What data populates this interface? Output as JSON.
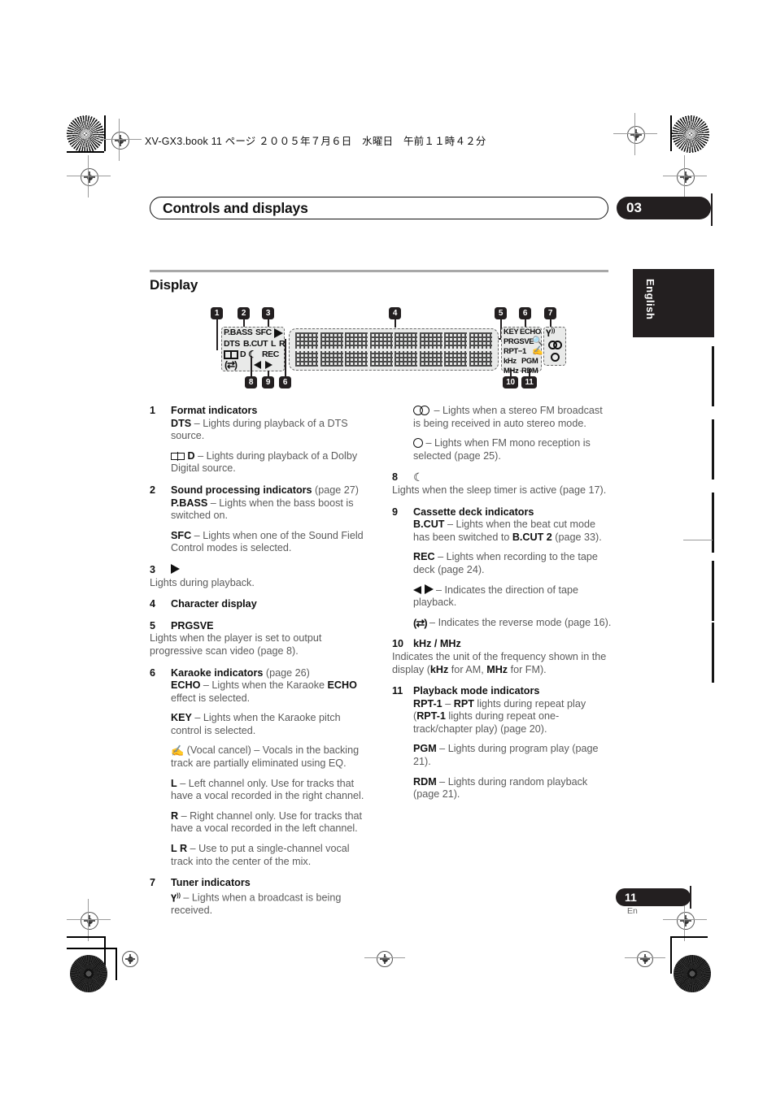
{
  "print_marks": {
    "file_stamp": "XV-GX3.book  11 ページ  ２００５年７月６日　水曜日　午前１１時４２分"
  },
  "header": {
    "chapter_title": "Controls and displays",
    "chapter_number": "03"
  },
  "section": {
    "title": "Display"
  },
  "language_tab": {
    "label": "English"
  },
  "figure": {
    "callouts": [
      "1",
      "2",
      "3",
      "4",
      "5",
      "6",
      "7",
      "8",
      "9",
      "10",
      "11"
    ],
    "lcd_labels": {
      "p_bass": "P.BASS",
      "sfc": "SFC",
      "dts": "DTS",
      "b_cut": "B.CUT",
      "left": "L",
      "right": "R",
      "dolby_d": "D",
      "rec": "REC",
      "key": "KEY",
      "echo": "ECHO",
      "prgsve": "PRGSVE",
      "rpt1": "RPT−1",
      "khz": "kHz",
      "pgm": "PGM",
      "mhz": "MHz",
      "rdm": "RDM"
    },
    "character_display_cells": 8
  },
  "left_column": [
    {
      "num": "1",
      "title": "Format indicators",
      "paragraphs": [
        {
          "lead_bold": "DTS",
          "text": " – Lights during playback of a DTS source."
        },
        {
          "icon": "dolby-icon",
          "lead_bold": "D",
          "text": " – Lights during playback of a Dolby Digital source."
        }
      ]
    },
    {
      "num": "2",
      "title": "Sound processing indicators",
      "title_suffix": " (page 27)",
      "paragraphs": [
        {
          "lead_bold": "P.BASS",
          "text": " – Lights when the bass boost is switched on."
        },
        {
          "lead_bold": "SFC",
          "text": " – Lights when one of the Sound Field Control modes is selected."
        }
      ]
    },
    {
      "num": "3",
      "title_icon": "play-triangle-icon",
      "flush_text": "Lights during playback."
    },
    {
      "num": "4",
      "title": "Character display"
    },
    {
      "num": "5",
      "title": "PRGSVE",
      "flush_text": "Lights when the player is set to output progressive scan video (page 8)."
    },
    {
      "num": "6",
      "title": "Karaoke indicators",
      "title_suffix": " (page 26)",
      "paragraphs": [
        {
          "lead_bold": "ECHO",
          "text": " – Lights when the Karaoke ",
          "bold_mid": "ECHO",
          "text2": " effect is selected."
        },
        {
          "lead_bold": "KEY",
          "text": " – Lights when the Karaoke pitch control is selected."
        },
        {
          "icon": "vocal-cancel-mic-icon",
          "text": " (Vocal cancel) – Vocals in the backing track are partially eliminated using EQ."
        },
        {
          "lead_bold": "L",
          "text": " – Left channel only. Use for tracks that have a vocal recorded in the right channel."
        },
        {
          "lead_bold": "R",
          "text": " – Right channel only. Use for tracks that have a vocal recorded in the left channel."
        },
        {
          "lead_bold": "L R",
          "text": " – Use to put a single-channel vocal track into the center of the mix."
        }
      ]
    },
    {
      "num": "7",
      "title": "Tuner indicators",
      "paragraphs": [
        {
          "icon": "antenna-icon",
          "text": " – Lights when a broadcast is being received."
        }
      ]
    }
  ],
  "right_column": [
    {
      "num": "",
      "paragraphs": [
        {
          "icon": "stereo-circles-icon",
          "text": " – Lights when a stereo FM broadcast is being received in auto stereo mode."
        },
        {
          "icon": "mono-circle-icon",
          "text": " – Lights when FM mono reception is selected (page 25)."
        }
      ]
    },
    {
      "num": "8",
      "title_icon": "sleep-moon-icon",
      "flush_text": "Lights when the sleep timer is active (page 17)."
    },
    {
      "num": "9",
      "title": "Cassette deck indicators",
      "paragraphs": [
        {
          "lead_bold": "B.CUT",
          "text": " – Lights when the beat cut mode has been switched to ",
          "bold_mid": "B.CUT 2",
          "text2": " (page 33)."
        },
        {
          "lead_bold": "REC",
          "text": " – Lights when recording to the tape deck (page 24)."
        },
        {
          "icon": "tape-direction-icon",
          "text": " – Indicates the direction of tape playback."
        },
        {
          "icon": "reverse-mode-icon",
          "text": " – Indicates the reverse mode (page 16)."
        }
      ]
    },
    {
      "num": "10",
      "title": "kHz / MHz",
      "flush_rich": {
        "pre": "Indicates the unit of the frequency shown in the display (",
        "b1": "kHz",
        "mid": " for AM, ",
        "b2": "MHz",
        "post": " for FM)."
      }
    },
    {
      "num": "11",
      "title": "Playback mode indicators",
      "paragraphs": [
        {
          "lead_bold": "RPT-1",
          "text": " – ",
          "bold_mid": "RPT",
          "text2": " lights during repeat play (",
          "bold_end": "RPT-1",
          "text3": " lights during repeat one-track/chapter play) (page 20)."
        },
        {
          "lead_bold": "PGM",
          "text": " – Lights during program play (page 21)."
        },
        {
          "lead_bold": "RDM",
          "text": " – Lights during random playback (page 21)."
        }
      ]
    }
  ],
  "footer": {
    "page_number": "11",
    "language_code": "En"
  }
}
